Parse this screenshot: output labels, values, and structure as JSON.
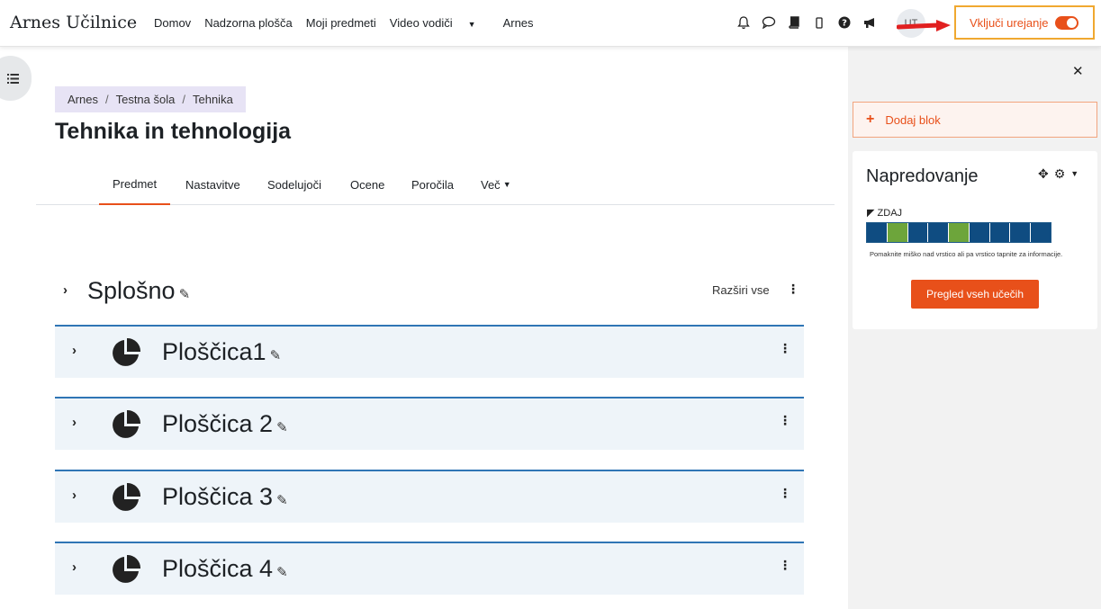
{
  "brand": "Arnes Učilnice",
  "nav": {
    "links": [
      "Domov",
      "Nadzorna plošča",
      "Moji predmeti",
      "Video vodiči",
      "Arnes"
    ],
    "dropdown_caret": "⌄",
    "icons": [
      "bell-icon",
      "chat-icon",
      "book-icon",
      "mobile-icon",
      "help-icon",
      "megaphone-icon"
    ],
    "avatar": "UT",
    "edit_mode_label": "Vključi urejanje",
    "edit_mode_on": true
  },
  "breadcrumb": [
    "Arnes",
    "Testna šola",
    "Tehnika"
  ],
  "page_title": "Tehnika in tehnologija",
  "tabs": [
    "Predmet",
    "Nastavitve",
    "Sodelujoči",
    "Ocene",
    "Poročila",
    "Več"
  ],
  "active_tab": "Predmet",
  "sections": {
    "general_title": "Splošno",
    "expand_all": "Razširi vse",
    "tiles": [
      "Ploščica1",
      "Ploščica 2",
      "Ploščica 3",
      "Ploščica 4"
    ]
  },
  "drawer": {
    "add_block": "Dodaj blok",
    "progress_block": {
      "title": "Napredovanje",
      "now_label": "ZDAJ",
      "cells": [
        "blue",
        "green",
        "blue",
        "blue",
        "green",
        "blue",
        "blue",
        "blue",
        "blue"
      ],
      "hint": "Pomaknite miško nad vrstico ali pa vrstico tapnite za informacije.",
      "overview_button": "Pregled vseh učečih"
    }
  },
  "colors": {
    "accent": "#e8501a",
    "section_border": "#2f75b5",
    "tile_bg": "#eef4f9",
    "progress_blue": "#0f4c81",
    "progress_green": "#6da53b",
    "breadcrumb_bg": "#e7e3f5",
    "highlight_box": "#f0a830",
    "arrow_red": "#e12020"
  }
}
